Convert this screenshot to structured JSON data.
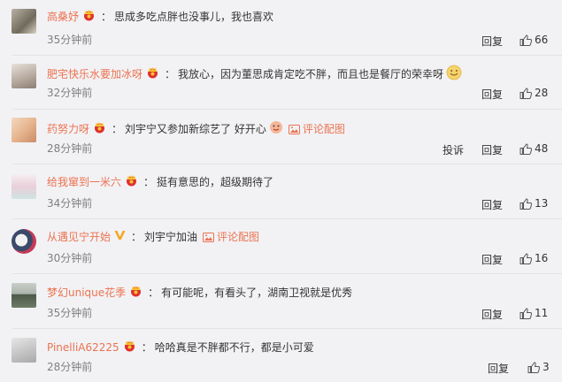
{
  "actions": {
    "reply": "回复",
    "report": "投诉",
    "reply_last": "回复"
  },
  "comments": [
    {
      "user": "高桑妤",
      "colon": "：",
      "text": "思成多吃点胖也没事儿，我也喜欢",
      "time": "35分钟前",
      "likes": "66"
    },
    {
      "user": "肥宅快乐水要加冰呀",
      "colon": "：",
      "text": "我放心，因为董思成肯定吃不胖，而且也是餐厅的荣幸呀",
      "time": "32分钟前",
      "likes": "28"
    },
    {
      "user": "药努力呀",
      "colon": "：",
      "text": "刘宇宁又参加新综艺了 好开心",
      "link": "评论配图",
      "time": "28分钟前",
      "likes": "48"
    },
    {
      "user": "给我窜到一米六",
      "colon": "：",
      "text": "挺有意思的，超级期待了",
      "time": "34分钟前",
      "likes": "13"
    },
    {
      "user": "从遇见宁开始",
      "colon": "：",
      "text": "刘宇宁加油",
      "link": "评论配图",
      "time": "30分钟前",
      "likes": "16"
    },
    {
      "user": "梦幻unique花季",
      "colon": "：",
      "text": "有可能呢，有看头了，湖南卫视就是优秀",
      "time": "35分钟前",
      "likes": "11"
    },
    {
      "user": "PinelliA62225",
      "colon": "：",
      "text": "哈哈真是不胖都不行，都是小可爱",
      "time": "28分钟前",
      "likes": "3"
    }
  ]
}
